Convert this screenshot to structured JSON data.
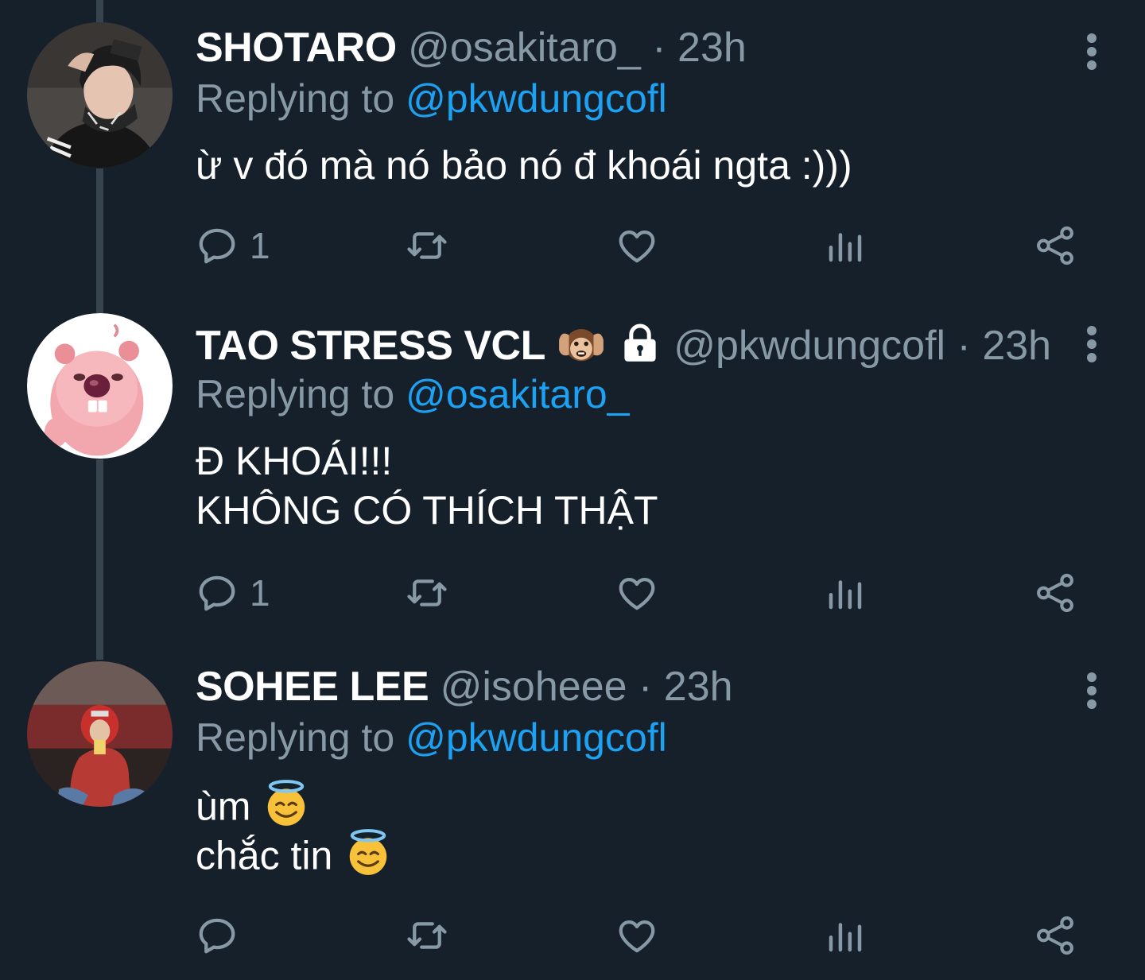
{
  "colors": {
    "background": "#15202b",
    "secondary_text": "#8899a6",
    "link": "#1da1f2",
    "thread_line": "#38444d"
  },
  "tweets": [
    {
      "name": "SHOTARO",
      "handle": "@osakitaro_",
      "separator": "·",
      "time": "23h",
      "replying_prefix": "Replying to",
      "replying_to": "@pkwdungcofl",
      "lines": [
        "ừ v đó mà nó bảo nó đ khoái ngta :)))"
      ],
      "reply_count": "1",
      "avatar_icon": "user-avatar-photo"
    },
    {
      "name": "TAO STRESS VCL",
      "name_emojis": [
        "hear-no-evil-monkey-icon",
        "lock-icon"
      ],
      "handle": "@pkwdungcofl",
      "separator": "·",
      "time": "23h",
      "replying_prefix": "Replying to",
      "replying_to": "@osakitaro_",
      "lines": [
        "Đ KHOÁI!!!",
        "KHÔNG CÓ THÍCH THẬT"
      ],
      "reply_count": "1",
      "avatar_icon": "pink-beaver-avatar"
    },
    {
      "name": "SOHEE LEE",
      "handle": "@isoheee",
      "separator": "·",
      "time": "23h",
      "replying_prefix": "Replying to",
      "replying_to": "@pkwdungcofl",
      "lines": [
        "ùm",
        "chắc tin"
      ],
      "line_emojis": [
        "smiling-face-with-halo-icon",
        "smiling-face-with-halo-icon"
      ],
      "reply_count": "",
      "avatar_icon": "user-avatar-photo"
    }
  ],
  "action_icons": [
    "reply-icon",
    "retweet-icon",
    "like-icon",
    "analytics-icon",
    "share-icon"
  ]
}
